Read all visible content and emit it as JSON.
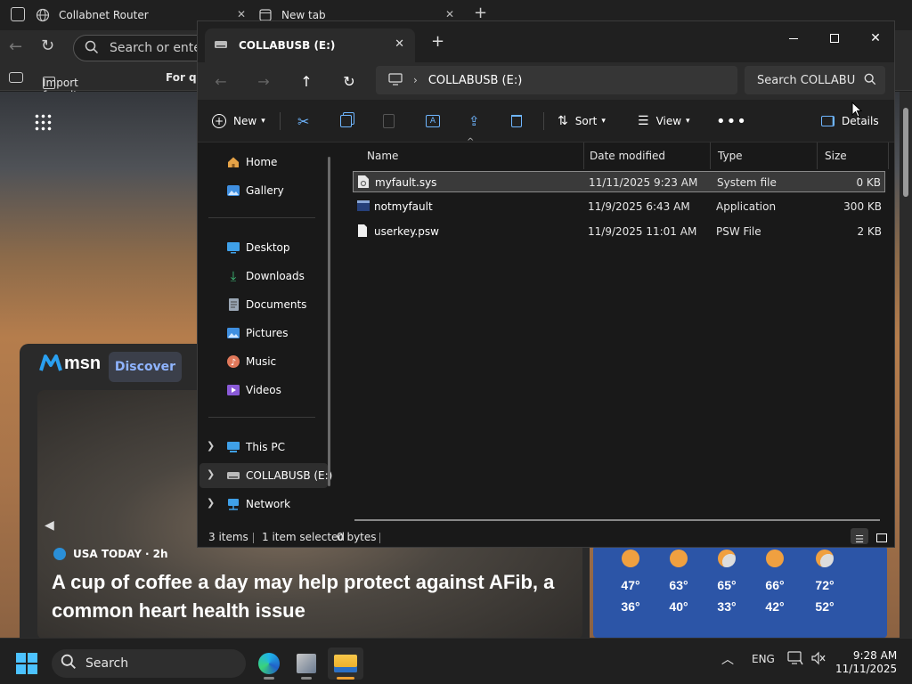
{
  "browser": {
    "tabs": [
      {
        "label": "Collabnet Router"
      },
      {
        "label": "New tab"
      }
    ],
    "address_placeholder": "Search or ente",
    "favorites": {
      "import_label": "Import favorites",
      "second_label": "For qu"
    },
    "msn": {
      "logo_text": "msn",
      "discover_label": "Discover",
      "source": "USA TODAY",
      "age": "2h",
      "headline": "A cup of coffee a day may help protect against AFib, a common heart health issue"
    },
    "weather": [
      {
        "high": "47°",
        "low": "36°"
      },
      {
        "high": "63°",
        "low": "40°"
      },
      {
        "high": "65°",
        "low": "33°"
      },
      {
        "high": "66°",
        "low": "42°"
      },
      {
        "high": "72°",
        "low": "52°"
      }
    ]
  },
  "explorer": {
    "tab_title": "COLLABUSB (E:)",
    "address_path": "COLLABUSB (E:)",
    "search_placeholder": "Search COLLABU",
    "toolbar": {
      "new_label": "New",
      "sort_label": "Sort",
      "view_label": "View",
      "details_label": "Details"
    },
    "nav": {
      "home": "Home",
      "gallery": "Gallery",
      "desktop": "Desktop",
      "downloads": "Downloads",
      "documents": "Documents",
      "pictures": "Pictures",
      "music": "Music",
      "videos": "Videos",
      "this_pc": "This PC",
      "drive": "COLLABUSB (E:)",
      "network": "Network"
    },
    "columns": {
      "name": "Name",
      "date": "Date modified",
      "type": "Type",
      "size": "Size"
    },
    "files": [
      {
        "name": "myfault.sys",
        "date": "11/11/2025 9:23 AM",
        "type": "System file",
        "size": "0 KB"
      },
      {
        "name": "notmyfault",
        "date": "11/9/2025 6:43 AM",
        "type": "Application",
        "size": "300 KB"
      },
      {
        "name": "userkey.psw",
        "date": "11/9/2025 11:01 AM",
        "type": "PSW File",
        "size": "2 KB"
      }
    ],
    "status": {
      "items": "3 items",
      "selected": "1 item selected",
      "bytes": "0 bytes"
    }
  },
  "taskbar": {
    "search_label": "Search",
    "language": "ENG",
    "time": "9:28 AM",
    "date": "11/11/2025"
  }
}
